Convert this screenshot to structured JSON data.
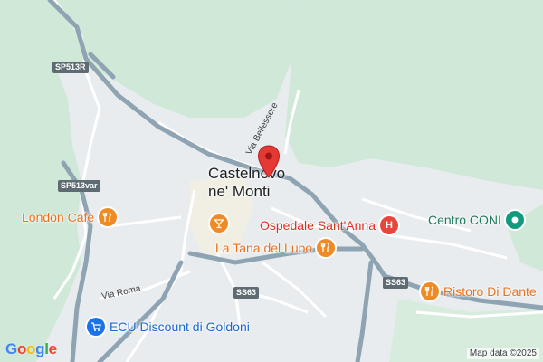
{
  "map": {
    "town_line1": "Castelnovo",
    "town_line2": "ne' Monti",
    "credit": "Map data ©2025",
    "google_logo": "Google",
    "marker_icon": "red-pin-icon",
    "colors": {
      "forest": "#cfe8d8",
      "urban": "#e9ecee",
      "highway": "#8fa4b3",
      "road": "#ffffff",
      "poi_food": "#f08a24",
      "poi_medical": "#e8453c",
      "poi_sports": "#129a7f",
      "poi_shop": "#1a73e8",
      "marker": "#e53935"
    },
    "road_shields": {
      "sp513r": "SP513R",
      "sp513var": "SP513var",
      "ss63_a": "SS63",
      "ss63_b": "SS63"
    },
    "streets": {
      "via_bellessere": "Via Bellessere",
      "via_roma": "Via Roma"
    },
    "pois": {
      "london_cafe": {
        "label": "London Cafè",
        "icon": "cutlery-icon"
      },
      "bar": {
        "label": "",
        "icon": "cocktail-icon"
      },
      "ospedale": {
        "label": "Ospedale Sant'Anna",
        "icon": "hospital-icon"
      },
      "centro_coni": {
        "label": "Centro CONI",
        "icon": "sports-icon"
      },
      "tana_del_lupo": {
        "label": "La Tana del Lupo",
        "icon": "cutlery-icon"
      },
      "ristoro": {
        "label": "Ristoro Di Dante",
        "icon": "cutlery-icon"
      },
      "ecu": {
        "label": "ECU Discount di Goldoni",
        "icon": "cart-icon"
      }
    }
  }
}
